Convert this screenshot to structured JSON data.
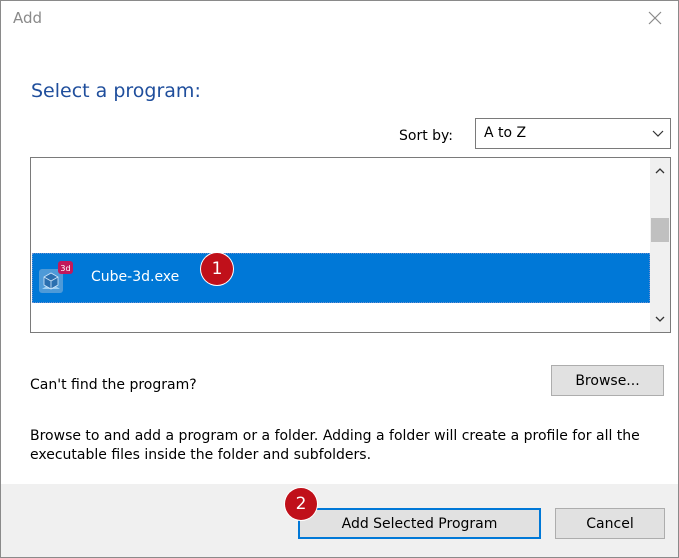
{
  "window": {
    "title": "Add"
  },
  "heading": "Select a program:",
  "sort": {
    "label": "Sort by:",
    "value": "A to Z"
  },
  "program_list": {
    "items": [
      {
        "label": "Cube-3d.exe",
        "icon": "cube-3d-app-icon",
        "selected": true
      }
    ]
  },
  "cant_find": "Can't find the program?",
  "browse_label": "Browse...",
  "description": "Browse to and add a program or a folder. Adding a folder will create a profile for all the executable files inside the folder and subfolders.",
  "buttons": {
    "add_selected": "Add Selected Program",
    "cancel": "Cancel"
  },
  "annotations": {
    "step1": "1",
    "step2": "2"
  },
  "colors": {
    "heading": "#1f4e9c",
    "selection": "#0078d7",
    "badge": "#c0101a"
  }
}
